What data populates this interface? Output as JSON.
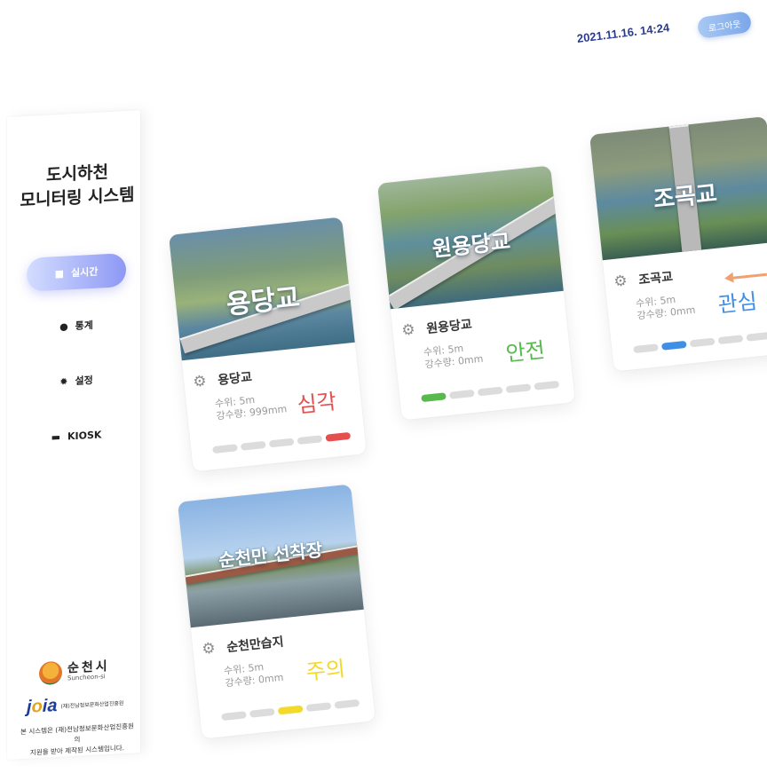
{
  "header": {
    "datetime": "2021.11.16.  14:24",
    "logout_label": "로그아웃"
  },
  "sidebar": {
    "title_line1": "도시하천",
    "title_line2": "모니터링 시스템",
    "items": [
      {
        "label": "실시간",
        "icon": "camera-icon",
        "active": true
      },
      {
        "label": "통계",
        "icon": "chart-icon",
        "active": false
      },
      {
        "label": "설정",
        "icon": "gear-icon",
        "active": false
      },
      {
        "label": "KIOSK",
        "icon": "monitor-icon",
        "active": false
      }
    ],
    "city_name": "순천시",
    "city_name_en": "Suncheon-si",
    "org_logo": "jcia",
    "org_name": "(재)전남정보문화산업진흥원",
    "footnote_line1": "본 시스템은 (재)전남정보문화산업진흥원의",
    "footnote_line2": "지원을 받아 제작된 시스템입니다."
  },
  "cards": [
    {
      "id": "yongdang",
      "overlay": "용당교",
      "name": "용당교",
      "water_level": "수위: 5m",
      "rainfall": "강수량: 999mm",
      "status": "심각",
      "status_color": "#e5504f",
      "level": 5
    },
    {
      "id": "wonyong",
      "overlay": "원용당교",
      "name": "원용당교",
      "water_level": "수위: 5m",
      "rainfall": "강수량: 0mm",
      "status": "안전",
      "status_color": "#58b94d",
      "level": 1
    },
    {
      "id": "jogok",
      "overlay": "조곡교",
      "name": "조곡교",
      "water_level": "수위: 5m",
      "rainfall": "강수량: 0mm",
      "status": "관심",
      "status_color": "#3f8fe6",
      "level": 2
    },
    {
      "id": "suncheon",
      "overlay": "순천만 선착장",
      "name": "순천만습지",
      "water_level": "수위: 5m",
      "rainfall": "강수량: 0mm",
      "status": "주의",
      "status_color": "#f2d92a",
      "level": 3
    }
  ]
}
